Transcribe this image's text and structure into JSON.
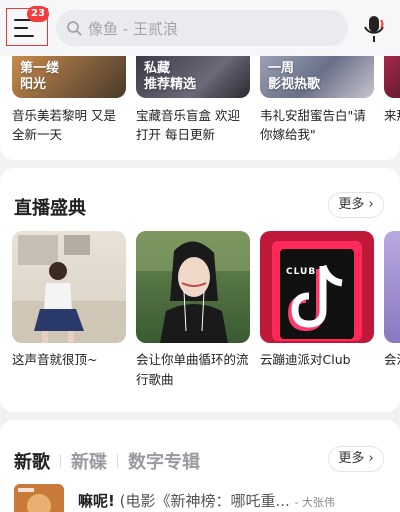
{
  "header": {
    "menu_badge": "23",
    "search_placeholder": "像鱼 - 王贰浪"
  },
  "recommend": {
    "items": [
      {
        "thumb_text": "第一缕\n阳光",
        "caption": "音乐美若黎明 又是全新一天"
      },
      {
        "thumb_text": "私藏\n推荐精选",
        "caption": "宝藏音乐盲盒 欢迎打开 每日更新"
      },
      {
        "thumb_text": "一周\n影视热歌",
        "caption": "韦礼安甜蜜告白\"请你嫁给我\""
      },
      {
        "thumb_text": "",
        "caption": "来那"
      }
    ]
  },
  "live": {
    "title": "直播盛典",
    "more_label": "更多",
    "items": [
      {
        "caption": "这声音就很顶~"
      },
      {
        "caption": "会让你单曲循环的流行歌曲"
      },
      {
        "caption": "云蹦迪派对Club",
        "thumb_label": "CLUB"
      },
      {
        "caption": "会流"
      }
    ]
  },
  "new_songs": {
    "tabs": [
      "新歌",
      "新碟",
      "数字专辑"
    ],
    "more_label": "更多",
    "first_song": {
      "title": "嘛呢!",
      "subtitle": "(电影《新神榜：哪吒重...",
      "artist": "- 大张伟"
    }
  },
  "colors": {
    "accent_red": "#f43c3c",
    "background": "#f2f2f4",
    "card": "#ffffff"
  }
}
